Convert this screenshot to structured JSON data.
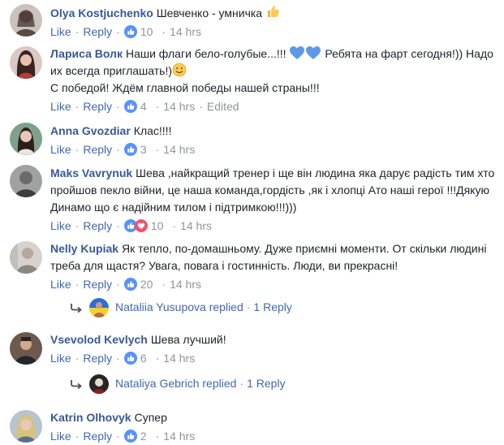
{
  "comments": [
    {
      "author": "Olya Kostjuchenko",
      "text": "Шевченко - умничка",
      "like": "Like",
      "reply": "Reply",
      "count": "10",
      "time": "14 hrs",
      "reactions": [
        "like-icon"
      ]
    },
    {
      "author": "Лариса Волк",
      "text1": "Наши флаги бело-голубые...!!!",
      "text2": "Ребята на фарт сегодня!)) Надо их всегда приглашать!)",
      "text3": "С победой! Ждём главной победы нашей страны!!!",
      "like": "Like",
      "reply": "Reply",
      "count": "4",
      "time": "14 hrs",
      "edited": "Edited",
      "reactions": [
        "like-icon"
      ]
    },
    {
      "author": "Anna Gvozdiar",
      "text": "Клас!!!!",
      "like": "Like",
      "reply": "Reply",
      "count": "3",
      "time": "14 hrs",
      "reactions": [
        "like-icon"
      ]
    },
    {
      "author": "Maks Vavrynuk",
      "text": "Шева ,найкращий тренер і ще він людина яка дарує радість тим хто пройшов пекло війни, це наша команда,гордість ,як і хлопці Ато наші герої !!!Дякую Динамо що є надійним тилом і підтримкою!!!)))",
      "like": "Like",
      "reply": "Reply",
      "count": "10",
      "time": "14 hrs",
      "reactions": [
        "like-icon",
        "love-icon"
      ]
    },
    {
      "author": "Nelly Kupiak",
      "text": "Як тепло, по-домашньому. Дуже приємні моменти. От скільки людині треба для щастя? Увага, повага і гостинність. Люди, ви прекрасні!",
      "like": "Like",
      "reply": "Reply",
      "count": "20",
      "time": "14 hrs",
      "reactions": [
        "like-icon"
      ],
      "reply_summary": {
        "name": "Nataliia Yusupova",
        "verb": "replied",
        "sep": "·",
        "count": "1 Reply"
      }
    },
    {
      "author": "Vsevolod Kevlych",
      "text": "Шева лучший!",
      "like": "Like",
      "reply": "Reply",
      "count": "6",
      "time": "14 hrs",
      "reactions": [
        "like-icon"
      ],
      "reply_summary": {
        "name": "Nataliya Gebrich",
        "verb": "replied",
        "sep": "·",
        "count": "1 Reply"
      }
    },
    {
      "author": "Katrin Olhovyk",
      "text": "Супер",
      "like": "Like",
      "reply": "Reply",
      "count": "2",
      "time": "14 hrs",
      "reactions": [
        "like-icon"
      ]
    }
  ],
  "ui": {
    "dot": "·"
  },
  "colors": {
    "link": "#4267b2",
    "author": "#385898",
    "meta": "#90949c",
    "heart": "#f25268",
    "like": "#5890ff"
  }
}
